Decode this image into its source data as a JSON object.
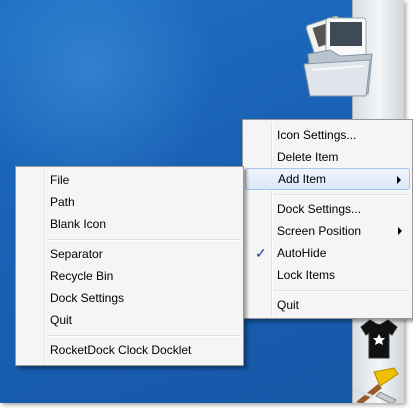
{
  "main_menu": {
    "items": [
      {
        "label": "Icon Settings..."
      },
      {
        "label": "Delete Item"
      },
      {
        "label": "Add Item",
        "submenu": true,
        "highlighted": true
      },
      {
        "label": "Dock Settings..."
      },
      {
        "label": "Screen Position",
        "submenu": true
      },
      {
        "label": "AutoHide",
        "checked": true
      },
      {
        "label": "Lock Items"
      },
      {
        "label": "Quit"
      }
    ]
  },
  "add_item_menu": {
    "items": [
      {
        "label": "File"
      },
      {
        "label": "Path"
      },
      {
        "label": "Blank Icon"
      },
      {
        "label": "Separator"
      },
      {
        "label": "Recycle Bin"
      },
      {
        "label": "Dock Settings"
      },
      {
        "label": "Quit"
      },
      {
        "label": "RocketDock Clock Docklet"
      }
    ]
  },
  "dock": {
    "icons": [
      "folder-icon",
      "tshirt-icon",
      "tools-icon"
    ],
    "background": "#e8ebef"
  },
  "colors": {
    "desktop": "#1a62b6",
    "highlight": "#dbe8fa",
    "menu_background": "#f5f5f5"
  },
  "check_glyph": "✓"
}
